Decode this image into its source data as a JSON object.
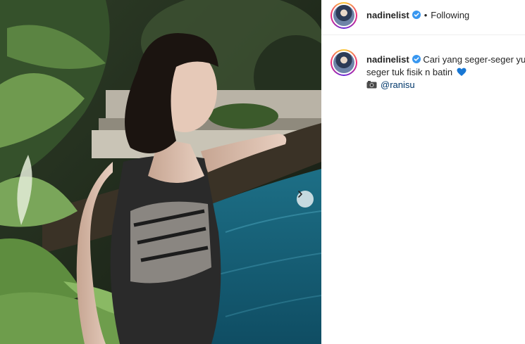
{
  "post": {
    "username": "nadinelist",
    "follow_status": "Following",
    "separator": "•",
    "caption": {
      "username": "nadinelist",
      "text_line1": "Cari yang seger-seger yu",
      "text_line2": "seger tuk fisik n batin",
      "mention": "@ranisu"
    }
  },
  "icons": {
    "verified": "verified-badge-icon",
    "next": "chevron-right-icon",
    "heart": "blue-heart-emoji",
    "camera": "camera-emoji"
  },
  "colors": {
    "verified_blue": "#3897f0",
    "mention": "#00376b",
    "heart_blue": "#1877d4"
  }
}
